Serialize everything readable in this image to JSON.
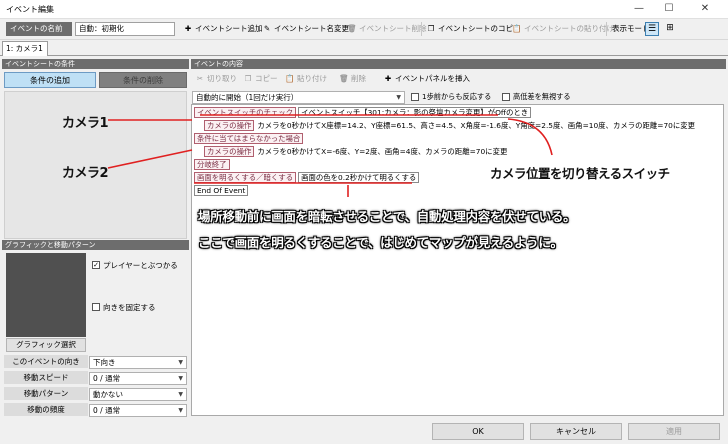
{
  "window": {
    "title": "イベント編集",
    "minimize_icon": "minimize-icon",
    "maximize_icon": "maximize-icon",
    "close_icon": "close-icon",
    "min_glyph": "—",
    "max_glyph": "☐",
    "close_glyph": "✕"
  },
  "toolbar": {
    "event_name_label": "イベントの名前",
    "event_name_value": "自動：初期化",
    "add_sheet": "イベントシート追加",
    "rename_sheet": "イベントシート名変更",
    "delete_sheet": "イベントシート削除",
    "copy_sheet": "イベントシートのコピー",
    "paste_sheet": "イベントシートの貼り付け",
    "display_mode": "表示モード"
  },
  "tabs": [
    {
      "label": "1: カメラ1"
    }
  ],
  "conditions": {
    "header": "イベントシートの条件",
    "add_button": "条件の追加",
    "delete_button": "条件の削除"
  },
  "graphic": {
    "header": "グラフィックと移動パターン",
    "collide_player": "プレイヤーとぶつかる",
    "collide_checked": true,
    "fix_direction": "向きを固定する",
    "fix_checked": false,
    "select_button": "グラフィック選択",
    "check_glyph": "✓",
    "rows": [
      {
        "label": "このイベントの向き",
        "value": "下向き"
      },
      {
        "label": "移動スピード",
        "value": "0 / 通常"
      },
      {
        "label": "移動パターン",
        "value": "動かない"
      },
      {
        "label": "移動の頻度",
        "value": "0 / 通常"
      }
    ]
  },
  "events": {
    "header": "イベントの内容",
    "cut": "切り取り",
    "copy": "コピー",
    "paste": "貼り付け",
    "delete": "削除",
    "insert_panel": "イベントパネルを挿入",
    "trigger_value": "自動的に開始（1回だけ実行）",
    "react_one_step": "1歩前からも反応する",
    "ignore_height": "高低差を無視する",
    "lines": [
      {
        "cmd": "イベントスイッチのチェック",
        "arg": "イベントスイッチ【301:カメラ：影の祭壇カメラ変更】がOffのとき",
        "text": ""
      },
      {
        "cmd": "カメラの操作",
        "arg": "",
        "text": "カメラを0秒かけてX座標=14.2、Y座標=61.5、高さ=4.5、X角度=-1.6度、Y角度=2.5度、画角=10度、カメラの距離=70に変更"
      },
      {
        "cmd": "条件に当てはまらなかった場合",
        "arg": "",
        "text": ""
      },
      {
        "cmd": "カメラの操作",
        "arg": "",
        "text": "カメラを0秒かけてX=-6度、Y=2度、画角=4度、カメラの距離=70に変更"
      },
      {
        "cmd": "分岐終了",
        "arg": "",
        "text": ""
      },
      {
        "cmd": "画面を明るくする／暗くする",
        "arg": "画面の色を0.2秒かけて明るくする",
        "text": ""
      },
      {
        "cmd": "End Of Event",
        "arg": "",
        "text": ""
      }
    ]
  },
  "annotations": {
    "camera1": "カメラ1",
    "camera2": "カメラ2",
    "switch_note": "カメラ位置を切り替えるスイッチ",
    "note_line1": "場所移動前に画面を暗転させることで、自動処理内容を伏せている。",
    "note_line2": "ここで画面を明るくすることで、はじめてマップが見えるように。"
  },
  "footer": {
    "ok": "OK",
    "cancel": "キャンセル",
    "apply": "適用"
  }
}
